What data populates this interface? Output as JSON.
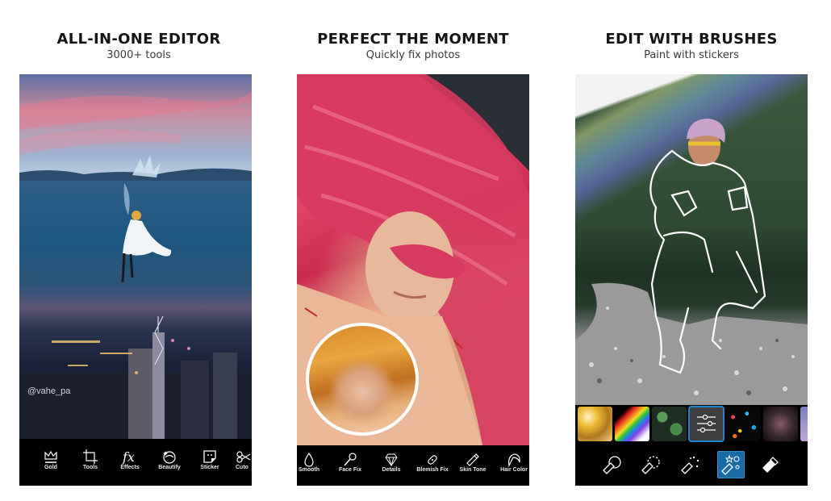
{
  "panels": [
    {
      "title": "ALL-IN-ONE EDITOR",
      "subtitle": "3000+ tools",
      "watermark": "@vahe_pa",
      "tools": [
        {
          "label": "Gold",
          "icon": "crown-icon"
        },
        {
          "label": "Tools",
          "icon": "crop-icon"
        },
        {
          "label": "Effects",
          "icon": "fx-icon"
        },
        {
          "label": "Beautify",
          "icon": "face-sparkle-icon"
        },
        {
          "label": "Sticker",
          "icon": "sticker-icon"
        },
        {
          "label": "Cuto",
          "icon": "scissors-icon"
        }
      ]
    },
    {
      "title": "PERFECT THE MOMENT",
      "subtitle": "Quickly fix photos",
      "tools": [
        {
          "label": "Smooth",
          "icon": "droplet-icon"
        },
        {
          "label": "Face Fix",
          "icon": "brush-icon"
        },
        {
          "label": "Details",
          "icon": "diamond-icon"
        },
        {
          "label": "Blemish Fix",
          "icon": "bandage-icon"
        },
        {
          "label": "Skin Tone",
          "icon": "tube-icon"
        },
        {
          "label": "Hair Color",
          "icon": "hair-icon"
        }
      ]
    },
    {
      "title": "EDIT WITH BRUSHES",
      "subtitle": "Paint with stickers",
      "stickers": [
        {
          "name": "gold-glitter",
          "selected": false
        },
        {
          "name": "rainbow",
          "selected": false
        },
        {
          "name": "clovers",
          "selected": false
        },
        {
          "name": "adjust",
          "selected": true
        },
        {
          "name": "confetti",
          "selected": false
        },
        {
          "name": "sparkle-dots",
          "selected": false
        },
        {
          "name": "hologram",
          "selected": false
        }
      ],
      "brushes": [
        {
          "icon": "brush-round-icon",
          "active": false
        },
        {
          "icon": "brush-dashed-icon",
          "active": false
        },
        {
          "icon": "brush-sparkle-icon",
          "active": false
        },
        {
          "icon": "brush-stickers-icon",
          "active": true
        },
        {
          "icon": "eraser-icon",
          "active": false
        }
      ]
    }
  ],
  "colors": {
    "accent": "#1a6aa3",
    "toolbar_bg": "#000000",
    "title_text": "#151515"
  }
}
